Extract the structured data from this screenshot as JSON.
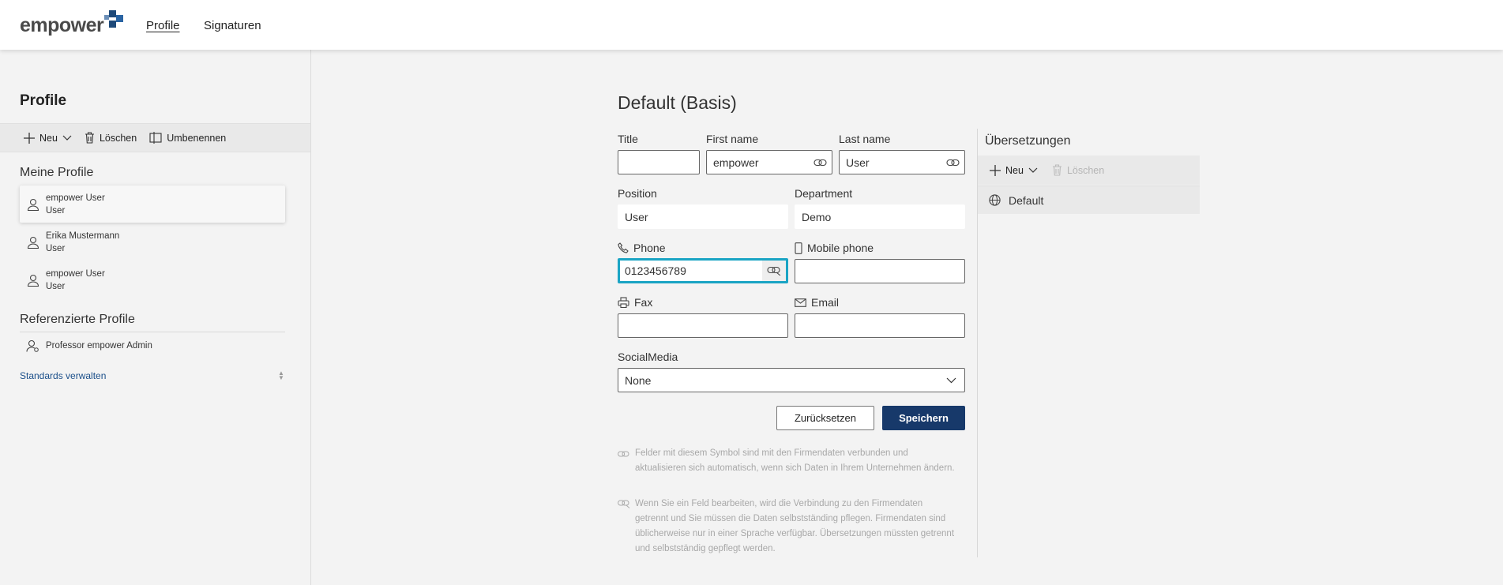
{
  "header": {
    "logo_text": "empower",
    "nav": [
      {
        "label": "Profile",
        "active": true
      },
      {
        "label": "Signaturen",
        "active": false
      }
    ]
  },
  "sidebar": {
    "title": "Profile",
    "toolbar": {
      "new": "Neu",
      "delete": "Löschen",
      "rename": "Umbenennen"
    },
    "my_profiles_heading": "Meine Profile",
    "my_profiles": [
      {
        "name": "empower User",
        "sub": "User",
        "selected": true
      },
      {
        "name": "Erika Mustermann",
        "sub": "User",
        "selected": false
      },
      {
        "name": "empower User",
        "sub": "User",
        "selected": false
      }
    ],
    "referenced_heading": "Referenzierte Profile",
    "referenced_profiles": [
      {
        "name": "Professor empower Admin"
      }
    ],
    "manage_link": "Standards verwalten"
  },
  "form": {
    "title": "Default (Basis)",
    "fields": {
      "title": {
        "label": "Title",
        "value": ""
      },
      "first_name": {
        "label": "First name",
        "value": "empower"
      },
      "last_name": {
        "label": "Last name",
        "value": "User"
      },
      "position": {
        "label": "Position",
        "value": "User"
      },
      "department": {
        "label": "Department",
        "value": "Demo"
      },
      "phone": {
        "label": "Phone",
        "value": "0123456789"
      },
      "mobile_phone": {
        "label": "Mobile phone",
        "value": ""
      },
      "fax": {
        "label": "Fax",
        "value": ""
      },
      "email": {
        "label": "Email",
        "value": ""
      },
      "social_media": {
        "label": "SocialMedia",
        "value": "None"
      }
    },
    "reset_label": "Zurücksetzen",
    "save_label": "Speichern",
    "info_linked": "Felder mit diesem Symbol sind mit den Firmendaten verbunden und aktualisieren sich automatisch, wenn sich Daten in Ihrem Unternehmen ändern.",
    "info_unlinked": "Wenn Sie ein Feld bearbeiten, wird die Verbindung zu den Firmendaten getrennt und Sie müssen die Daten selbstständing pflegen. Firmendaten sind üblicherweise nur in einer Sprache verfügbar. Übersetzungen müssten getrennt und selbstständig gepflegt werden."
  },
  "translations": {
    "title": "Übersetzungen",
    "new": "Neu",
    "delete": "Löschen",
    "items": [
      {
        "label": "Default"
      }
    ]
  },
  "colors": {
    "primary": "#17396a",
    "focus": "#1aa4c4",
    "link": "#1b4f8a"
  }
}
